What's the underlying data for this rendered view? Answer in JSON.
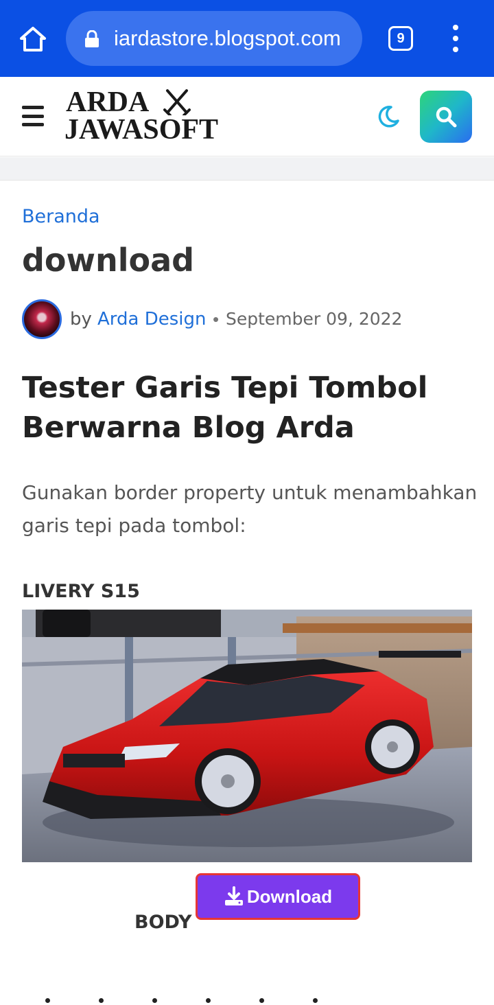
{
  "browser": {
    "url": "iardastore.blogspot.com",
    "tab_count": "9"
  },
  "site": {
    "logo_line1": "ARDA",
    "logo_line2": "JAWASOFT"
  },
  "breadcrumb": "Beranda",
  "page_title": "download",
  "meta": {
    "by": "by",
    "author": "Arda Design",
    "separator": "•",
    "date": "September 09, 2022"
  },
  "post": {
    "title": "Tester Garis Tepi Tombol Berwarna Blog Arda",
    "body": "Gunakan border property untuk menambahkan garis tepi pada tombol:"
  },
  "section_label": "LIVERY S15",
  "body_label": "BODY",
  "download_button": "Download",
  "colors": {
    "browser_bar": "#0b50e4",
    "link": "#1f6fd8",
    "button_bg": "#7c3aed",
    "button_border": "#e63636",
    "car": "#d81c1c"
  },
  "icons": [
    "home-icon",
    "lock-icon",
    "tabs-icon",
    "more-vert-icon",
    "hamburger-icon",
    "crossed-swords-icon",
    "moon-icon",
    "search-icon",
    "download-icon"
  ]
}
